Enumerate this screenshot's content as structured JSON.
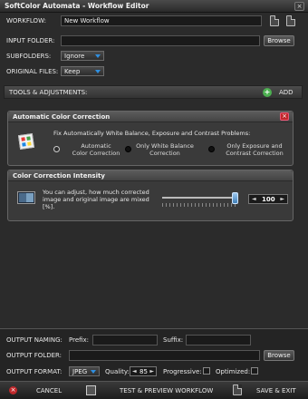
{
  "window": {
    "title": "SoftColor Automata - Workflow Editor",
    "close_glyph": "×"
  },
  "workflow": {
    "label": "WORKFLOW:",
    "value": "New Workflow"
  },
  "input_folder": {
    "label": "INPUT FOLDER:",
    "value": "",
    "browse_label": "Browse"
  },
  "subfolders": {
    "label": "SUBFOLDERS:",
    "selected": "Ignore"
  },
  "original_files": {
    "label": "ORIGINAL FILES:",
    "selected": "Keep"
  },
  "tools": {
    "label": "TOOLS & ADJUSTMENTS:",
    "add_label": "ADD",
    "add_icon": "+"
  },
  "auto_color": {
    "title": "Automatic Color Correction",
    "description": "Fix Automatically White Balance, Exposure and Contrast Problems:",
    "options": [
      {
        "label_line1": "Automatic",
        "label_line2": "Color Correction",
        "selected": false
      },
      {
        "label_line1": "Only White Balance",
        "label_line2": "Correction",
        "selected": true
      },
      {
        "label_line1": "Only Exposure and",
        "label_line2": "Contrast Correction",
        "selected": true
      }
    ],
    "close_glyph": "×"
  },
  "intensity": {
    "title": "Color Correction Intensity",
    "description_line1": "You can adjust, how much corrected",
    "description_line2": "image and original image are mixed",
    "description_line3": "[%].",
    "value": "100",
    "level_percent": 100,
    "dec_glyph": "◄",
    "inc_glyph": "►"
  },
  "output": {
    "naming_label": "OUTPUT NAMING:",
    "prefix_label": "Prefix:",
    "prefix_value": "",
    "suffix_label": "Suffix:",
    "suffix_value": "",
    "folder_label": "OUTPUT FOLDER:",
    "folder_value": "",
    "browse_label": "Browse",
    "format_label": "OUTPUT FORMAT:",
    "format_selected": "JPEG",
    "quality_label": "Quality:",
    "quality_value": "85",
    "progressive_label": "Progressive:",
    "optimized_label": "Optimized:"
  },
  "actions": {
    "cancel_label": "CANCEL",
    "test_label": "TEST & PREVIEW WORKFLOW",
    "save_label": "SAVE & EXIT"
  },
  "colors": {
    "accent_blue": "#2f8fe0",
    "close_red": "#c0282b",
    "add_green": "#4caf50"
  }
}
